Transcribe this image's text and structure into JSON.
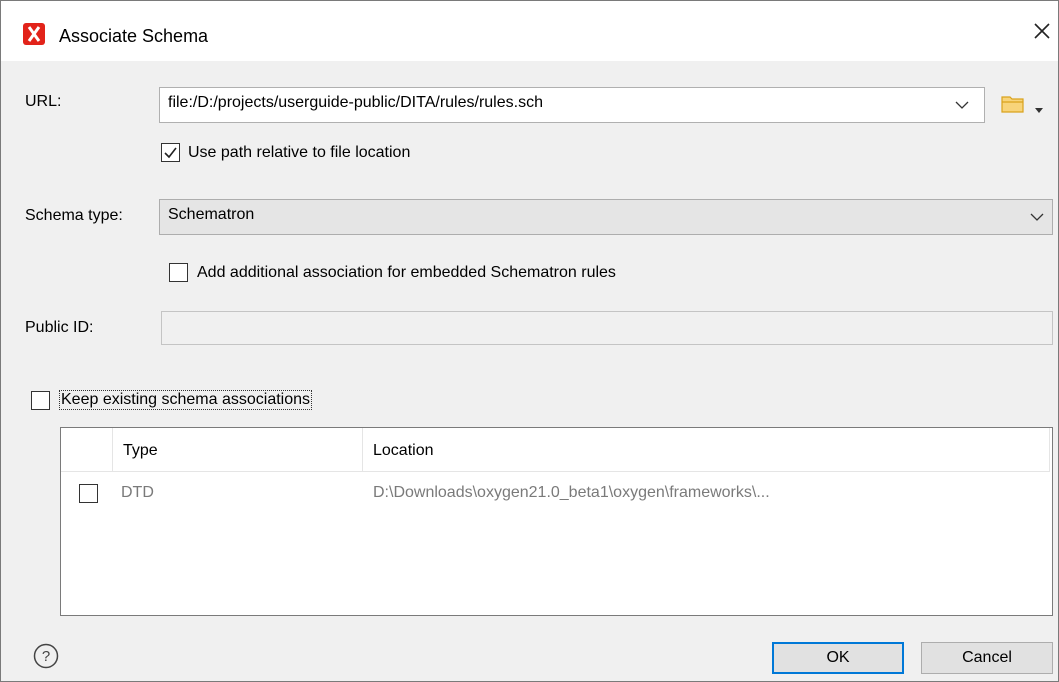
{
  "window": {
    "title": "Associate Schema"
  },
  "url": {
    "label": "URL:",
    "value": "file:/D:/projects/userguide-public/DITA/rules/rules.sch",
    "use_relative_label": "Use path relative to file location",
    "use_relative_checked": true
  },
  "schema_type": {
    "label": "Schema type:",
    "value": "Schematron"
  },
  "embedded": {
    "label": "Add additional association for embedded Schematron rules",
    "checked": false
  },
  "public_id": {
    "label": "Public ID:",
    "value": ""
  },
  "keep_existing": {
    "label": "Keep existing schema associations",
    "checked": false
  },
  "table": {
    "columns": [
      "Type",
      "Location"
    ],
    "rows": [
      {
        "checked": false,
        "type": "DTD",
        "location": "D:\\Downloads\\oxygen21.0_beta1\\oxygen\\frameworks\\..."
      }
    ]
  },
  "buttons": {
    "ok": "OK",
    "cancel": "Cancel"
  },
  "colors": {
    "accent": "#0078d7",
    "app_icon": "#e2231a",
    "folder": "#e8a317"
  }
}
